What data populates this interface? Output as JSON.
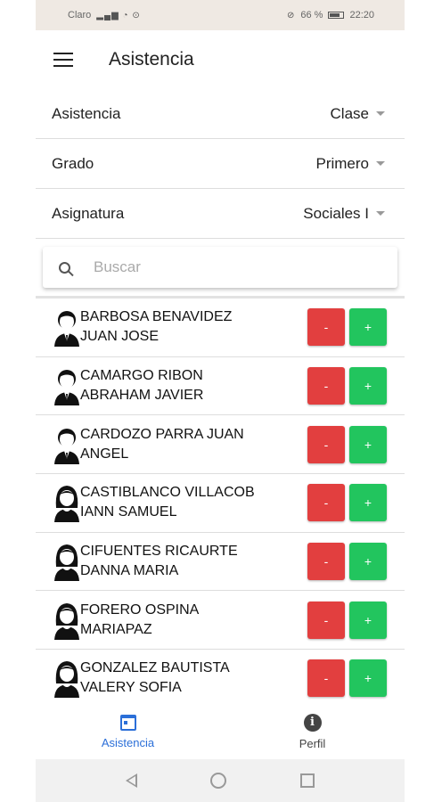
{
  "status_bar": {
    "carrier": "Claro",
    "battery": "66 %",
    "time": "22:20"
  },
  "app_bar": {
    "title": "Asistencia"
  },
  "filters": [
    {
      "label": "Asistencia",
      "value": "Clase"
    },
    {
      "label": "Grado",
      "value": "Primero"
    },
    {
      "label": "Asignatura",
      "value": "Sociales I"
    }
  ],
  "search": {
    "placeholder": "Buscar",
    "value": ""
  },
  "students": [
    {
      "name_line1": "BARBOSA BENAVIDEZ",
      "name_line2": "JUAN JOSE",
      "avatar": "male-avatar-icon"
    },
    {
      "name_line1": "CAMARGO RIBON",
      "name_line2": "ABRAHAM JAVIER",
      "avatar": "male-avatar-icon"
    },
    {
      "name_line1": "CARDOZO PARRA JUAN",
      "name_line2": "ANGEL",
      "avatar": "male-avatar-icon"
    },
    {
      "name_line1": "CASTIBLANCO VILLACOB",
      "name_line2": "IANN SAMUEL",
      "avatar": "female-avatar-icon"
    },
    {
      "name_line1": "CIFUENTES RICAURTE",
      "name_line2": "DANNA MARIA",
      "avatar": "female-avatar-icon"
    },
    {
      "name_line1": "FORERO OSPINA",
      "name_line2": "MARIAPAZ",
      "avatar": "female-avatar-icon"
    },
    {
      "name_line1": "GONZALEZ BAUTISTA",
      "name_line2": "VALERY SOFIA",
      "avatar": "female-avatar-icon"
    }
  ],
  "buttons": {
    "minus_label": "-",
    "plus_label": "+"
  },
  "bottom_nav": [
    {
      "label": "Asistencia",
      "icon": "calendar-icon",
      "active": true
    },
    {
      "label": "Perfil",
      "icon": "info-icon",
      "active": false
    }
  ],
  "colors": {
    "minus": "#e23f3f",
    "plus": "#22c55e",
    "active_nav": "#2b6fd8"
  }
}
